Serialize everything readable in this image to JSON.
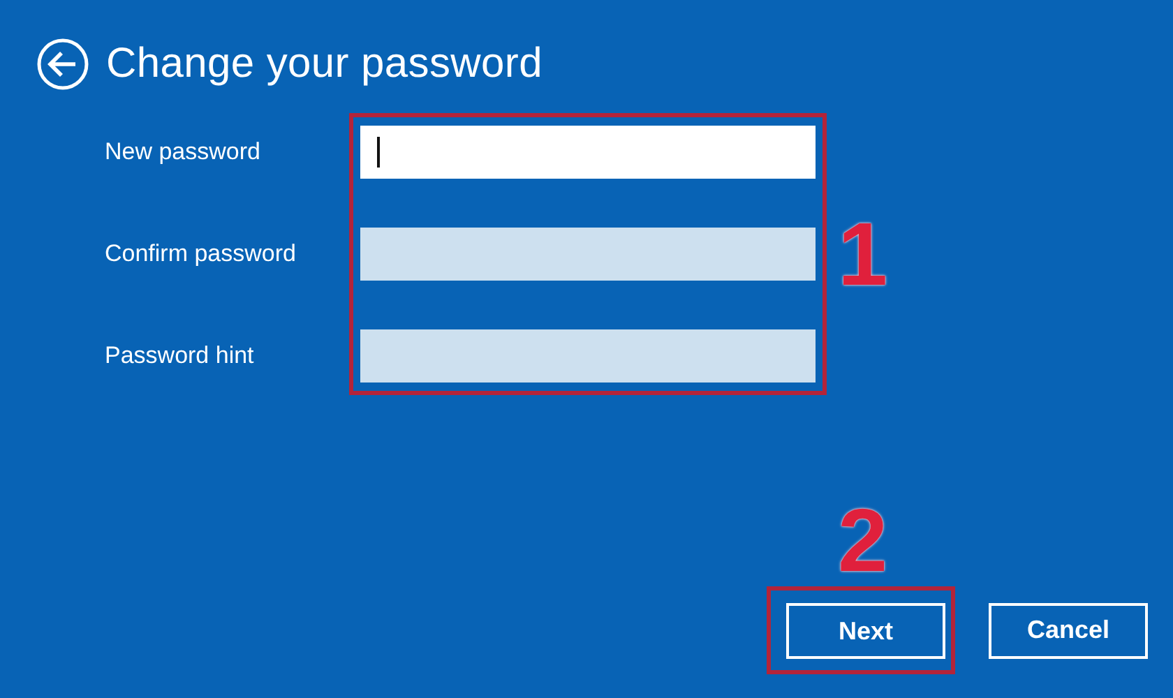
{
  "window": {
    "title": "Change your password"
  },
  "fields": [
    {
      "label": "New password",
      "focused": true
    },
    {
      "label": "Confirm password",
      "focused": false
    },
    {
      "label": "Password hint",
      "focused": false
    }
  ],
  "buttons": [
    {
      "label": "Next"
    },
    {
      "label": "Cancel"
    }
  ],
  "annotations": [
    {
      "label": "1"
    },
    {
      "label": "2"
    }
  ]
}
